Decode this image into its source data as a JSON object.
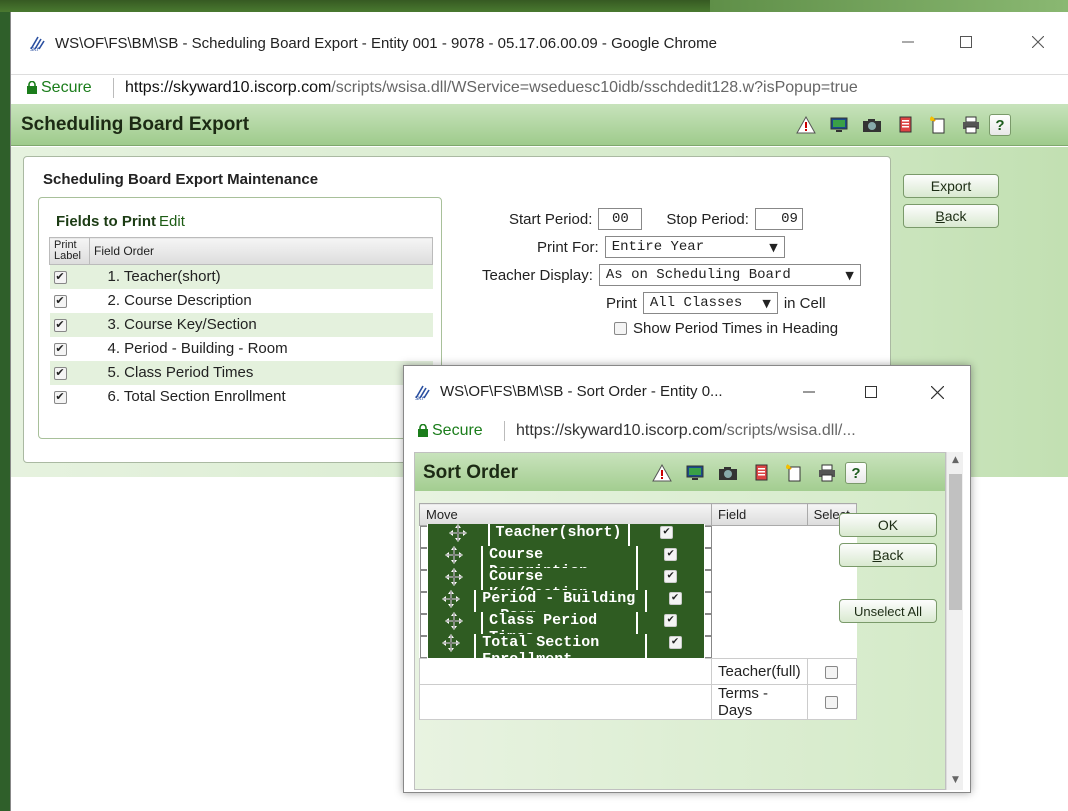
{
  "main_window": {
    "title": "WS\\OF\\FS\\BM\\SB - Scheduling Board Export - Entity 001 - 9078 - 05.17.06.00.09 - Google Chrome",
    "secure_label": "Secure",
    "url_host": "https://skyward10.iscorp.com",
    "url_path": "/scripts/wsisa.dll/WService=wseduesc10idb/sschdedit128.w?isPopup=true"
  },
  "page": {
    "header_title": "Scheduling Board Export",
    "panel_title": "Scheduling Board Export Maintenance",
    "fields_box": {
      "title": "Fields to Print",
      "edit_link": "Edit",
      "col_print_label": "Print Label",
      "col_field_order": "Field Order",
      "rows": [
        {
          "checked": true,
          "label": "1. Teacher(short)"
        },
        {
          "checked": true,
          "label": "2. Course Description"
        },
        {
          "checked": true,
          "label": "3. Course Key/Section"
        },
        {
          "checked": true,
          "label": "4. Period - Building - Room"
        },
        {
          "checked": true,
          "label": "5. Class Period Times"
        },
        {
          "checked": true,
          "label": "6. Total Section Enrollment"
        }
      ]
    },
    "form": {
      "start_period_label": "Start Period:",
      "start_period_value": "00",
      "stop_period_label": "Stop Period:",
      "stop_period_value": "09",
      "print_for_label": "Print For:",
      "print_for_value": "Entire Year",
      "teacher_display_label": "Teacher Display:",
      "teacher_display_value": "As on Scheduling Board",
      "print_label": "Print",
      "print_value": "All Classes",
      "in_cell_label": "in Cell",
      "show_period_times_label": "Show Period Times in Heading",
      "show_period_times_checked": false
    },
    "buttons": {
      "export": "Export",
      "back_prefix": "",
      "back_underline": "B",
      "back_rest": "ack"
    }
  },
  "popup": {
    "title": "WS\\OF\\FS\\BM\\SB - Sort Order - Entity 0...",
    "secure_label": "Secure",
    "url_host": "https://skyward10.iscorp.com",
    "url_path": "/scripts/wsisa.dll/...",
    "header_title": "Sort Order",
    "col_move": "Move",
    "col_field": "Field",
    "col_select": "Select",
    "rows": [
      {
        "field": "Teacher(short)",
        "selected": true
      },
      {
        "field": "Course Description",
        "selected": true
      },
      {
        "field": "Course Key/Section",
        "selected": true
      },
      {
        "field": "Period - Building - Room",
        "selected": true
      },
      {
        "field": "Class Period Times",
        "selected": true
      },
      {
        "field": "Total Section Enrollment",
        "selected": true
      },
      {
        "field": "Teacher(full)",
        "selected": false
      },
      {
        "field": "Terms - Days",
        "selected": false
      }
    ],
    "buttons": {
      "ok": "OK",
      "back_underline": "B",
      "back_rest": "ack",
      "unselect_all": "Unselect All"
    }
  },
  "icons": [
    "alert-icon",
    "monitor-icon",
    "camera-icon",
    "document-icon",
    "new-document-icon",
    "printer-icon",
    "help-icon"
  ],
  "colors": {
    "selected_row": "#2f5c22",
    "header_green": "#a3cd90",
    "secure_green": "#1b7d1b"
  }
}
